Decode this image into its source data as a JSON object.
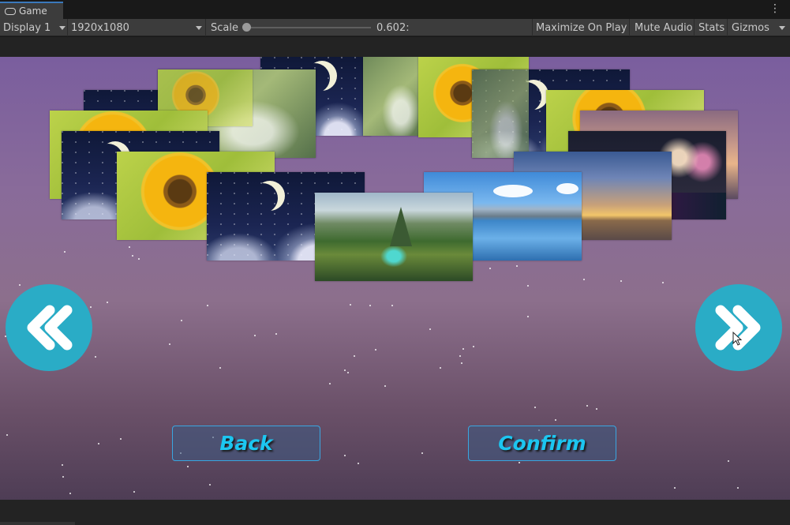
{
  "editor": {
    "tab_title": "Game",
    "tab_icon": "gamepad-icon",
    "menu_icon": "kebab-menu-icon",
    "display": "Display 1",
    "resolution": "1920x1080",
    "scale_label": "Scale",
    "scale_value": "0.602:",
    "maximize_on_play": "Maximize On Play",
    "mute_audio": "Mute Audio",
    "stats": "Stats",
    "gizmos": "Gizmos"
  },
  "game": {
    "prev_icon": "double-chevron-left-icon",
    "next_icon": "double-chevron-right-icon",
    "back_label": "Back",
    "confirm_label": "Confirm",
    "colors": {
      "arrow_circle": "#2aacc6",
      "button_text": "#1cc6f0",
      "button_border": "#3aa6e0"
    },
    "gallery": [
      "sunflower",
      "night-moon",
      "mist",
      "sunset",
      "fireworks",
      "lake",
      "valley"
    ]
  }
}
